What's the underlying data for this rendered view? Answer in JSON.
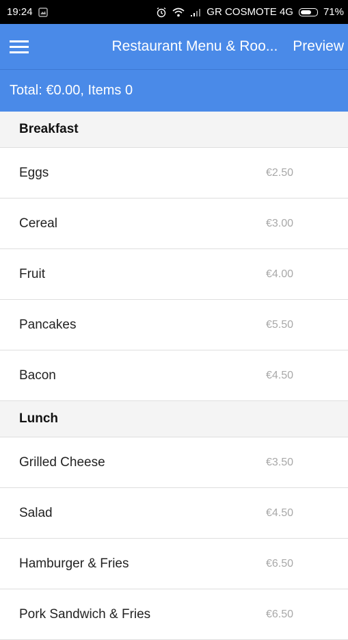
{
  "status_bar": {
    "time": "19:24",
    "carrier": "GR COSMOTE 4G",
    "battery": "71%",
    "battery_level": 0.71
  },
  "app_bar": {
    "title": "Restaurant Menu & Roo...",
    "preview_label": "Preview",
    "color": "#4a8ae8"
  },
  "summary": {
    "total_text": "Total: €0.00, Items 0"
  },
  "sections": [
    {
      "title": "Breakfast",
      "items": [
        {
          "name": "Eggs",
          "price": "€2.50"
        },
        {
          "name": "Cereal",
          "price": "€3.00"
        },
        {
          "name": "Fruit",
          "price": "€4.00"
        },
        {
          "name": "Pancakes",
          "price": "€5.50"
        },
        {
          "name": "Bacon",
          "price": "€4.50"
        }
      ]
    },
    {
      "title": "Lunch",
      "items": [
        {
          "name": "Grilled Cheese",
          "price": "€3.50"
        },
        {
          "name": "Salad",
          "price": "€4.50"
        },
        {
          "name": "Hamburger & Fries",
          "price": "€6.50"
        },
        {
          "name": "Pork Sandwich & Fries",
          "price": "€6.50"
        }
      ]
    }
  ]
}
